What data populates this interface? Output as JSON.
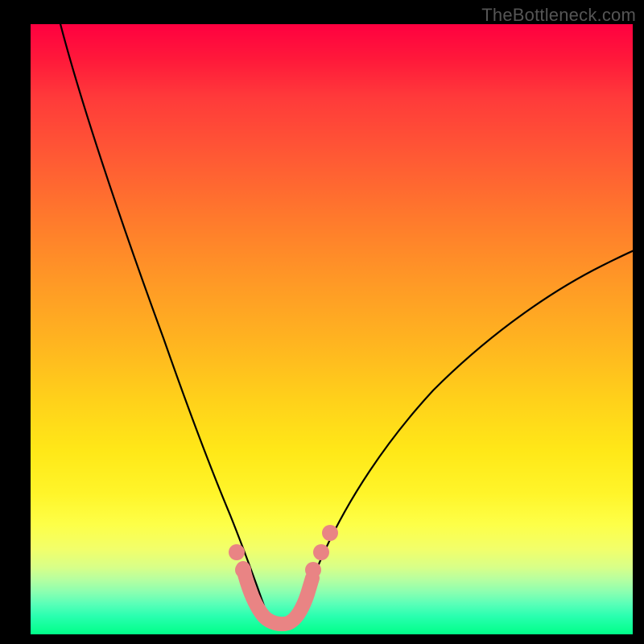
{
  "watermark": "TheBottleneck.com",
  "colors": {
    "background": "#000000",
    "gradient_top": "#ff0040",
    "gradient_bottom": "#00ff88",
    "curve": "#000000",
    "highlight": "#e98484"
  },
  "chart_data": {
    "type": "line",
    "title": "",
    "xlabel": "",
    "ylabel": "",
    "xlim": [
      0,
      100
    ],
    "ylim": [
      0,
      100
    ],
    "series": [
      {
        "name": "bottleneck-curve-left",
        "x": [
          5,
          8,
          11,
          14,
          17,
          20,
          23,
          26,
          28,
          30,
          31.5,
          33,
          34.5,
          36,
          37.5,
          39
        ],
        "y": [
          100,
          92,
          84,
          76,
          67,
          58,
          48,
          38,
          29,
          21,
          15,
          10,
          6.5,
          4,
          2,
          1
        ]
      },
      {
        "name": "bottleneck-curve-right",
        "x": [
          43,
          45,
          47,
          49,
          52,
          55,
          59,
          64,
          70,
          77,
          85,
          94,
          100
        ],
        "y": [
          1,
          2,
          4,
          6.5,
          10,
          14,
          19,
          25,
          32,
          39,
          46,
          53,
          58
        ]
      },
      {
        "name": "highlight-u",
        "x": [
          35.5,
          36.5,
          38,
          40,
          42,
          43.5,
          44.5
        ],
        "y": [
          10,
          6,
          3,
          1.5,
          3,
          6,
          10
        ]
      }
    ],
    "points": [
      {
        "name": "dot-left-upper",
        "x": 35.0,
        "y": 12.5
      },
      {
        "name": "dot-left-lower",
        "x": 36.0,
        "y": 9.0
      },
      {
        "name": "dot-right-1",
        "x": 45.5,
        "y": 10.0
      },
      {
        "name": "dot-right-2",
        "x": 47.0,
        "y": 13.0
      },
      {
        "name": "dot-right-3",
        "x": 48.5,
        "y": 16.0
      }
    ]
  }
}
